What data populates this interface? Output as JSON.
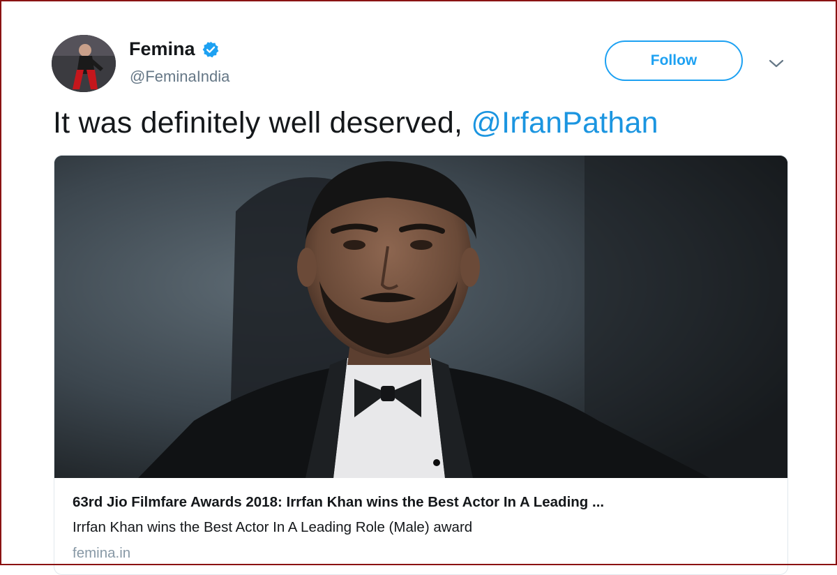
{
  "author": {
    "display_name": "Femina",
    "handle": "@FeminaIndia",
    "verified": true,
    "avatar_icon": "profile-photo"
  },
  "actions": {
    "follow_label": "Follow",
    "menu_icon": "chevron-down-icon"
  },
  "tweet": {
    "text": "It was definitely well deserved, ",
    "mention": "@IrfanPathan"
  },
  "card": {
    "image_alt": "portrait photo",
    "title": "63rd Jio Filmfare Awards 2018: Irrfan Khan wins the Best Actor In A Leading ...",
    "description": "Irrfan Khan wins the Best Actor In A Leading Role (Male) award",
    "domain": "femina.in"
  },
  "colors": {
    "accent": "#1da1f2",
    "mention": "#1b95e0",
    "secondary_text": "#657786",
    "frame": "#8a1212"
  }
}
